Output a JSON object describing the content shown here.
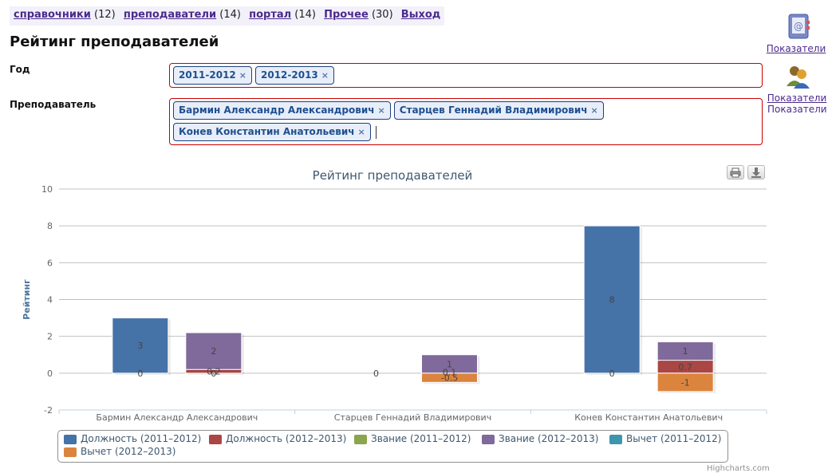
{
  "nav": {
    "items": [
      {
        "label": "справочники",
        "count": "(12)"
      },
      {
        "label": "преподаватели",
        "count": "(14)"
      },
      {
        "label": "портал",
        "count": "(14)"
      },
      {
        "label": "Прочее",
        "count": "(30)"
      },
      {
        "label": "Выход",
        "count": ""
      }
    ]
  },
  "page": {
    "title": "Рейтинг преподавателей"
  },
  "filters": {
    "year": {
      "label": "Год",
      "tags": [
        "2011-2012",
        "2012-2013"
      ]
    },
    "teacher": {
      "label": "Преподаватель",
      "tags": [
        "Бармин Александр Александрович",
        "Старцев Геннадий Владимирович",
        "Конев Константин Анатольевич"
      ]
    }
  },
  "tag_remove_glyph": "×",
  "side": {
    "indicators_label": "Показатели",
    "teacher_indicators_label": "Показатели преподавателей",
    "teacher_indicators_visible": "Показатели преподавател"
  },
  "chart_data": {
    "type": "bar",
    "stacking": "normal",
    "title": "Рейтинг преподавателей",
    "ylabel": "Рейтинг",
    "xlabel": "",
    "ylim": [
      -2,
      10
    ],
    "yticks": [
      -2,
      0,
      2,
      4,
      6,
      8,
      10
    ],
    "grid": true,
    "categories": [
      "Бармин Александр Александрович",
      "Старцев Геннадий Владимирович",
      "Конев Константин Анатольевич"
    ],
    "stacks": [
      "2011-2012",
      "2012-2013"
    ],
    "series": [
      {
        "name": "Должность (2011–2012)",
        "stack": "2011-2012",
        "color": "#4572A7",
        "values": [
          3,
          0,
          8
        ]
      },
      {
        "name": "Должность (2012–2013)",
        "stack": "2012-2013",
        "color": "#AA4643",
        "values": [
          0.2,
          0,
          0.7
        ]
      },
      {
        "name": "Звание (2011–2012)",
        "stack": "2011-2012",
        "color": "#89A54E",
        "values": [
          0,
          0,
          0
        ]
      },
      {
        "name": "Звание (2012–2013)",
        "stack": "2012-2013",
        "color": "#80699B",
        "values": [
          2,
          1,
          1
        ]
      },
      {
        "name": "Вычет (2011–2012)",
        "stack": "2011-2012",
        "color": "#3D96AE",
        "values": [
          0,
          0,
          0
        ]
      },
      {
        "name": "Вычет (2012–2013)",
        "stack": "2012-2013",
        "color": "#DB843D",
        "values": [
          0,
          -0.5,
          -1
        ]
      }
    ],
    "data_labels": [
      {
        "category": 0,
        "stack": "2011-2012",
        "value": 0,
        "text": "0"
      },
      {
        "category": 0,
        "stack": "2011-2012",
        "value": 3,
        "text": "3"
      },
      {
        "category": 0,
        "stack": "2012-2013",
        "value": 0,
        "text": "0"
      },
      {
        "category": 0,
        "stack": "2012-2013",
        "value": 2,
        "text": "2"
      },
      {
        "category": 0,
        "stack": "2012-2013",
        "value": 0.2,
        "text": "0.2"
      },
      {
        "category": 1,
        "stack": "2011-2012",
        "value": 0,
        "text": "0"
      },
      {
        "category": 1,
        "stack": "2012-2013",
        "value": 1,
        "text": "1"
      },
      {
        "category": 1,
        "stack": "2012-2013",
        "value": 0.1,
        "text": "0.1"
      },
      {
        "category": 1,
        "stack": "2012-2013",
        "value": -0.5,
        "text": "-0.5"
      },
      {
        "category": 2,
        "stack": "2011-2012",
        "value": 0,
        "text": "0"
      },
      {
        "category": 2,
        "stack": "2011-2012",
        "value": 8,
        "text": "8"
      },
      {
        "category": 2,
        "stack": "2012-2013",
        "value": 1,
        "text": "1"
      },
      {
        "category": 2,
        "stack": "2012-2013",
        "value": 0.7,
        "text": "0.7"
      },
      {
        "category": 2,
        "stack": "2012-2013",
        "value": -1,
        "text": "-1"
      }
    ],
    "legend": {
      "placement": "bottom",
      "layout": "horizontal"
    },
    "credits": "Highcharts.com"
  }
}
